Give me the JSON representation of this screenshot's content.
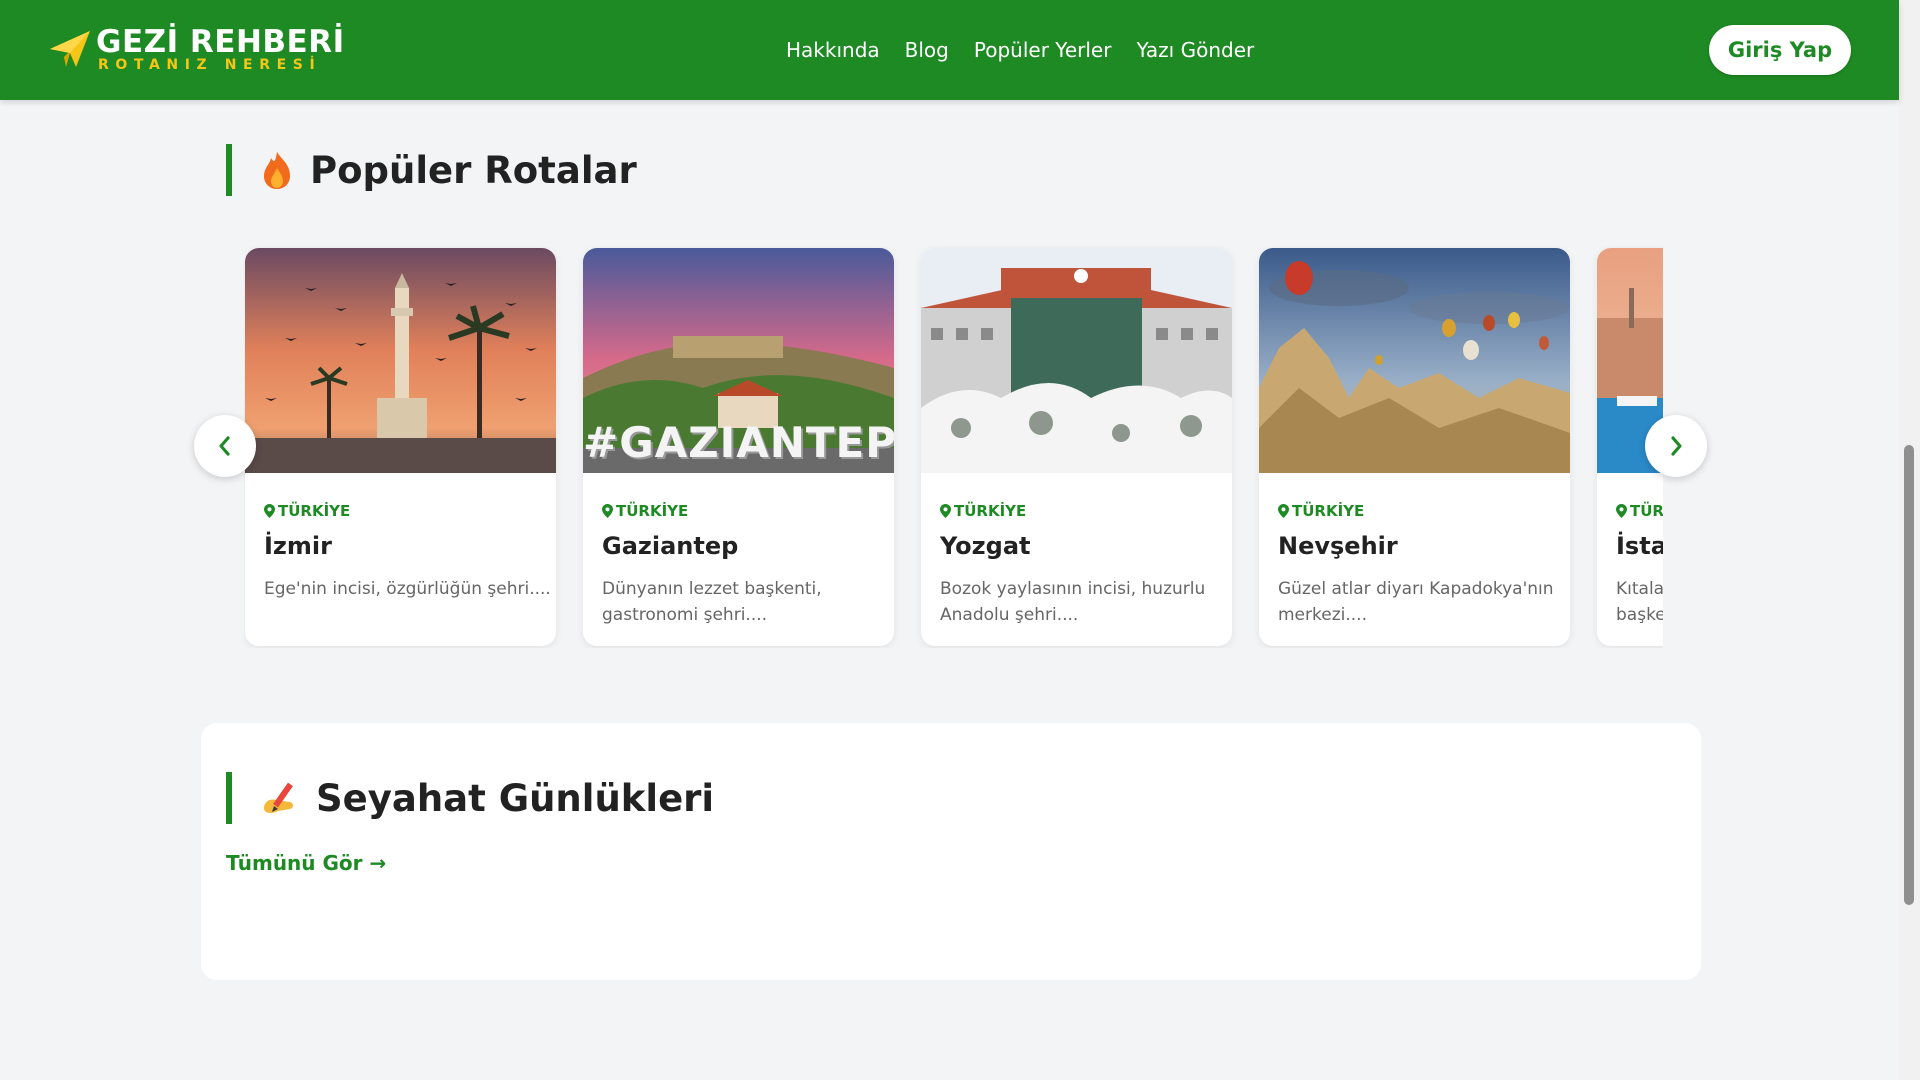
{
  "header": {
    "logo_title": "GEZİ REHBERİ",
    "logo_subtitle": "ROTANIZ NERESİ",
    "nav": [
      "Hakkında",
      "Blog",
      "Popüler Yerler",
      "Yazı Gönder"
    ],
    "login_label": "Giriş Yap"
  },
  "popular": {
    "title": "Popüler Rotalar",
    "cards": [
      {
        "country": "TÜRKİYE",
        "name": "İzmir",
        "desc": "Ege'nin incisi, özgürlüğün şehri...."
      },
      {
        "country": "TÜRKİYE",
        "name": "Gaziantep",
        "desc": "Dünyanın lezzet başkenti, gastronomi şehri....",
        "image_text": "#GAZIANTEP"
      },
      {
        "country": "TÜRKİYE",
        "name": "Yozgat",
        "desc": "Bozok yaylasının incisi, huzurlu Anadolu şehri...."
      },
      {
        "country": "TÜRKİYE",
        "name": "Nevşehir",
        "desc": "Güzel atlar diyarı Kapadokya'nın merkezi...."
      },
      {
        "country": "TÜRKİYE",
        "name": "İstanbul",
        "desc": "Kıtaları birleştiren şehir, kültür başkenti...."
      }
    ]
  },
  "diaries": {
    "title": "Seyahat Günlükleri",
    "see_all": "Tümünü Gör →"
  },
  "colors": {
    "brand_green": "#1e8a23",
    "logo_yellow": "#f5c518",
    "page_bg": "#f3f4f6"
  },
  "icons": {
    "logo": "paper-plane-icon",
    "popular": "fire-icon",
    "diaries": "writing-hand-icon",
    "country": "map-pin-icon",
    "prev": "chevron-left-icon",
    "next": "chevron-right-icon"
  }
}
